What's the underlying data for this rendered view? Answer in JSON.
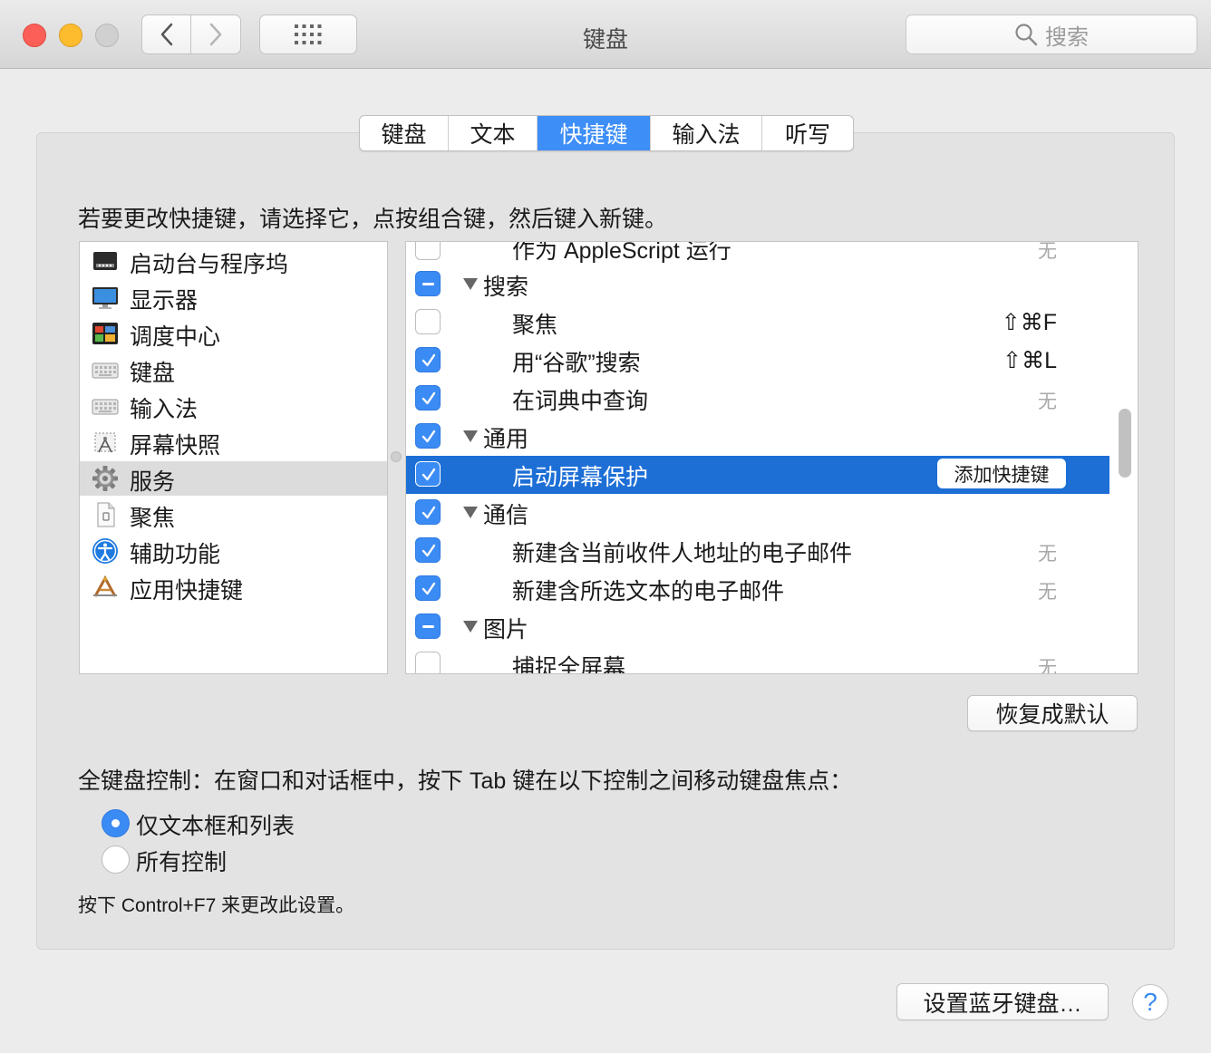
{
  "window": {
    "title": "键盘",
    "search_placeholder": "搜索"
  },
  "tabs": [
    {
      "label": "键盘",
      "active": false
    },
    {
      "label": "文本",
      "active": false
    },
    {
      "label": "快捷键",
      "active": true
    },
    {
      "label": "输入法",
      "active": false
    },
    {
      "label": "听写",
      "active": false
    }
  ],
  "instruction": "若要更改快捷键，请选择它，点按组合键，然后键入新键。",
  "categories": [
    {
      "label": "启动台与程序坞",
      "icon": "launchpad-dock-icon"
    },
    {
      "label": "显示器",
      "icon": "display-icon"
    },
    {
      "label": "调度中心",
      "icon": "mission-control-icon"
    },
    {
      "label": "键盘",
      "icon": "keyboard-icon"
    },
    {
      "label": "输入法",
      "icon": "input-method-icon"
    },
    {
      "label": "屏幕快照",
      "icon": "screenshot-icon"
    },
    {
      "label": "服务",
      "icon": "services-gear-icon",
      "selected": true
    },
    {
      "label": "聚焦",
      "icon": "spotlight-icon"
    },
    {
      "label": "辅助功能",
      "icon": "accessibility-icon"
    },
    {
      "label": "应用快捷键",
      "icon": "app-shortcuts-icon"
    }
  ],
  "shortcuts": [
    {
      "label": "作为 AppleScript 运行",
      "kind": "item",
      "check": "off",
      "shortcut": "无"
    },
    {
      "label": "搜索",
      "kind": "group",
      "check": "mixed",
      "shortcut": ""
    },
    {
      "label": "聚焦",
      "kind": "item",
      "check": "off",
      "shortcut": "⇧⌘F"
    },
    {
      "label": "用“谷歌”搜索",
      "kind": "item",
      "check": "on",
      "shortcut": "⇧⌘L"
    },
    {
      "label": "在词典中查询",
      "kind": "item",
      "check": "on",
      "shortcut": "无"
    },
    {
      "label": "通用",
      "kind": "group",
      "check": "on",
      "shortcut": ""
    },
    {
      "label": "启动屏幕保护",
      "kind": "item",
      "check": "on",
      "shortcut": "",
      "selected": true,
      "button": "添加快捷键"
    },
    {
      "label": "通信",
      "kind": "group",
      "check": "on",
      "shortcut": ""
    },
    {
      "label": "新建含当前收件人地址的电子邮件",
      "kind": "item",
      "check": "on",
      "shortcut": "无"
    },
    {
      "label": "新建含所选文本的电子邮件",
      "kind": "item",
      "check": "on",
      "shortcut": "无"
    },
    {
      "label": "图片",
      "kind": "group",
      "check": "mixed",
      "shortcut": ""
    },
    {
      "label": "捕捉全屏幕",
      "kind": "item",
      "check": "off",
      "shortcut": "无"
    }
  ],
  "buttons": {
    "reset": "恢复成默认",
    "bluetooth": "设置蓝牙键盘…",
    "help": "?"
  },
  "full_keyboard": {
    "title": "全键盘控制：在窗口和对话框中，按下 Tab 键在以下控制之间移动键盘焦点：",
    "options": [
      {
        "label": "仅文本框和列表",
        "selected": true
      },
      {
        "label": "所有控制",
        "selected": false
      }
    ],
    "note": "按下 Control+F7 来更改此设置。"
  },
  "colors": {
    "accent": "#3b8bf4",
    "selection": "#1d6fd6"
  }
}
